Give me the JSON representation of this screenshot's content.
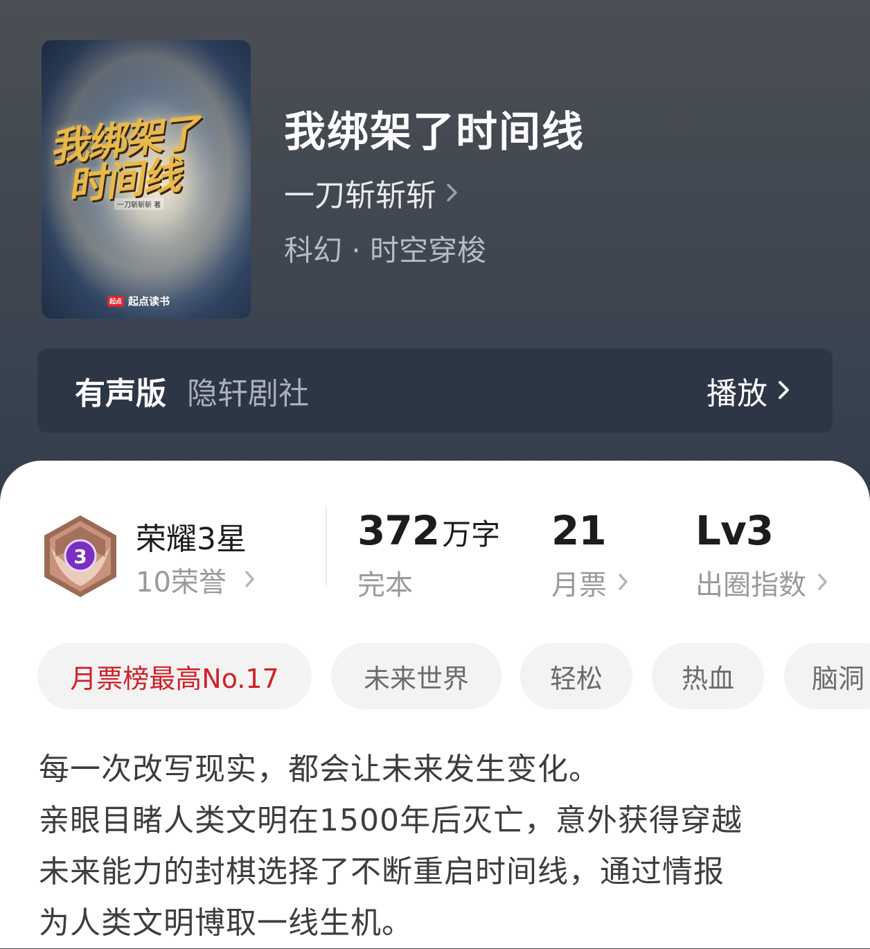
{
  "book": {
    "title": "我绑架了时间线",
    "author": "一刀斩斩斩",
    "genre": "科幻 · 时空穿梭",
    "cover": {
      "title_line1": "我绑架了",
      "title_line2": "时间线",
      "author": "一刀斩斩斩 著",
      "brand_logo": "起点",
      "brand": "起点读书"
    }
  },
  "audio": {
    "label": "有声版",
    "studio": "隐轩剧社",
    "play_label": "播放"
  },
  "honor": {
    "badge_level": "3",
    "title": "荣耀3星",
    "subtitle": "10荣誉"
  },
  "stats": {
    "words_value": "372",
    "words_unit": "万字",
    "words_label": "完本",
    "votes_value": "21",
    "votes_label": "月票",
    "level_value": "Lv3",
    "level_label": "出圈指数"
  },
  "tags": [
    {
      "label": "月票榜最高No.17",
      "highlight": true
    },
    {
      "label": "未来世界"
    },
    {
      "label": "轻松"
    },
    {
      "label": "热血"
    },
    {
      "label": "脑洞"
    }
  ],
  "description": [
    "每一次改写现实，都会让未来发生变化。",
    "亲眼目睹人类文明在1500年后灭亡，意外获得穿越",
    "未来能力的封棋选择了不断重启时间线，通过情报",
    "为人类文明博取一线生机。"
  ],
  "colors": {
    "hero_bg": "#434952",
    "audio_bar_bg": "#2d3644",
    "accent_red": "#d0202a",
    "badge_purple": "#7a2fc0",
    "badge_bronze": "#9b6a55"
  }
}
